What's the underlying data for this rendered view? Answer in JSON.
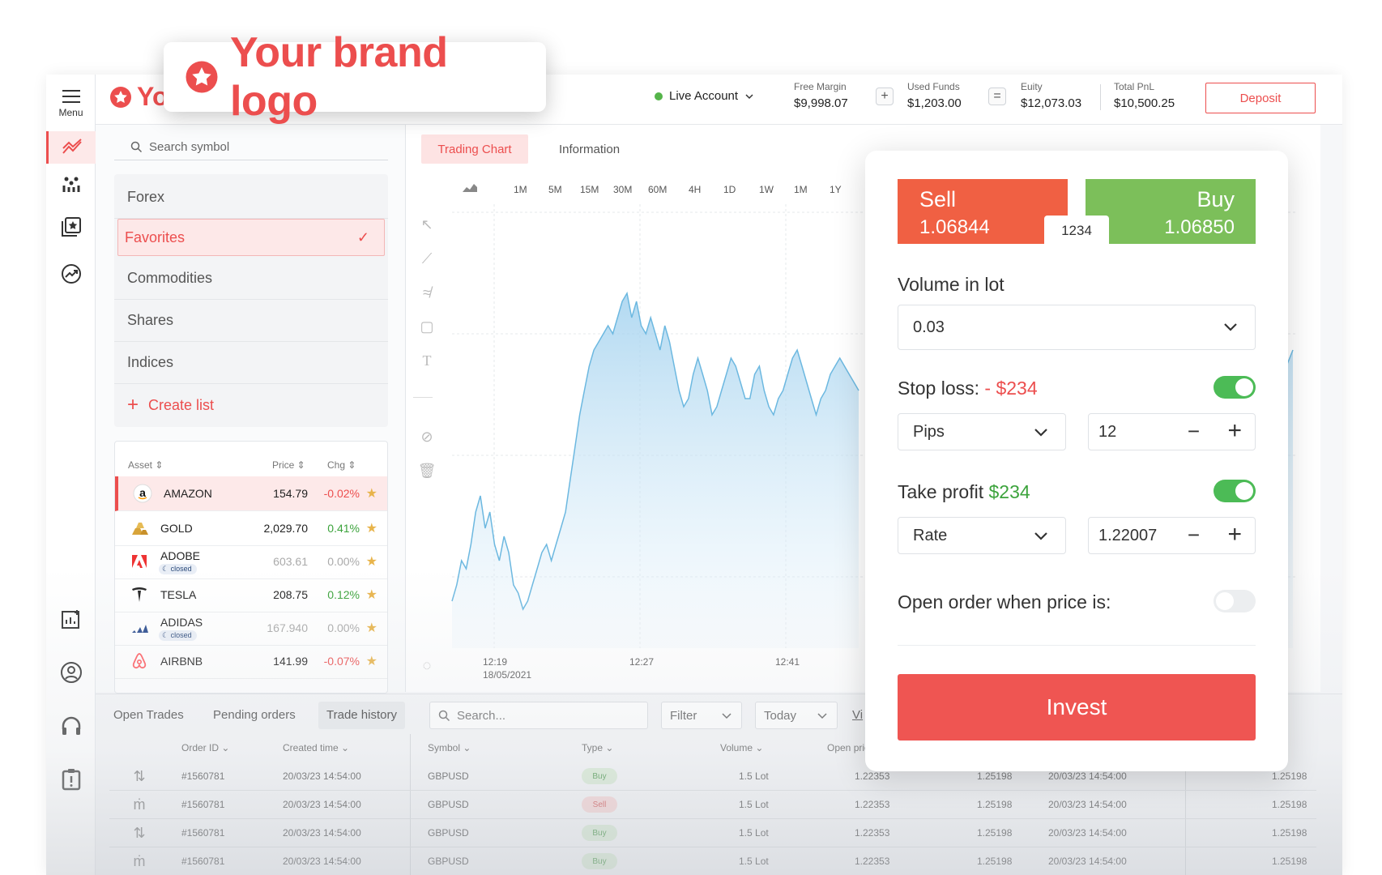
{
  "brand": {
    "logo_small": "Yo",
    "logo_popup": "Your brand logo",
    "accent": "#ec4e4e"
  },
  "rail": {
    "menu_label": "Menu"
  },
  "header": {
    "account": "Live Account",
    "stats": [
      {
        "label": "Free Margin",
        "value": "$9,998.07"
      },
      {
        "label": "Used Funds",
        "value": "$1,203.00"
      },
      {
        "label": "Euity",
        "value": "$12,073.03"
      },
      {
        "label": "Total PnL",
        "value": "$10,500.25"
      }
    ],
    "op_plus": "+",
    "op_equals": "=",
    "deposit": "Deposit"
  },
  "symbols": {
    "search_placeholder": "Search symbol",
    "categories": [
      "Forex",
      "Favorites",
      "Commodities",
      "Shares",
      "Indices"
    ],
    "create_list": "Create list",
    "columns": {
      "asset": "Asset",
      "price": "Price",
      "chg": "Chg"
    },
    "closed_label": "closed",
    "assets": [
      {
        "name": "AMAZON",
        "price": "154.79",
        "chg": "-0.02%",
        "trend": "neg",
        "closed": false,
        "icon": "a"
      },
      {
        "name": "GOLD",
        "price": "2,029.70",
        "chg": "0.41%",
        "trend": "pos",
        "closed": false,
        "icon": "gold"
      },
      {
        "name": "ADOBE",
        "price": "603.61",
        "chg": "0.00%",
        "trend": "zero",
        "closed": true,
        "icon": "adobe"
      },
      {
        "name": "TESLA",
        "price": "208.75",
        "chg": "0.12%",
        "trend": "pos",
        "closed": false,
        "icon": "T"
      },
      {
        "name": "ADIDAS",
        "price": "167.940",
        "chg": "0.00%",
        "trend": "zero",
        "closed": true,
        "icon": "adidas"
      },
      {
        "name": "AIRBNB",
        "price": "141.99",
        "chg": "-0.07%",
        "trend": "neg",
        "closed": false,
        "icon": "airbnb"
      }
    ]
  },
  "chart": {
    "tabs": [
      "Trading Chart",
      "Information"
    ],
    "timeframes": [
      "1M",
      "5M",
      "15M",
      "30M",
      "60M",
      "4H",
      "1D",
      "1W",
      "1M",
      "1Y"
    ],
    "x_labels": [
      "12:19",
      "18/05/2021",
      "12:27",
      "12:41"
    ],
    "line_color": "#6cb8e0"
  },
  "ticket": {
    "sell_label": "Sell",
    "sell_price": "1.06844",
    "buy_label": "Buy",
    "buy_price": "1.06850",
    "spread": "1234",
    "volume_label": "Volume in lot",
    "volume_value": "0.03",
    "stop_loss_label": "Stop loss:",
    "stop_loss_value": "- $234",
    "stop_loss_mode": "Pips",
    "stop_loss_amount": "12",
    "take_profit_label": "Take profit",
    "take_profit_value": "$234",
    "take_profit_mode": "Rate",
    "take_profit_amount": "1.22007",
    "open_order_label": "Open order when price is:",
    "invest": "Invest"
  },
  "trades": {
    "tabs": [
      "Open Trades",
      "Pending orders",
      "Trade history"
    ],
    "search_placeholder": "Search...",
    "filter": "Filter",
    "today": "Today",
    "view": "Vi",
    "columns": [
      "Order ID",
      "Created time",
      "Symbol",
      "Type",
      "Volume",
      "Open pric"
    ],
    "rows": [
      {
        "id": "#1560781",
        "time": "20/03/23 14:54:00",
        "symbol": "GBPUSD",
        "type": "Buy",
        "volume": "1.5 Lot",
        "open": "1.22353",
        "close": "1.25198",
        "closed_time": "20/03/23 14:54:00",
        "last": "1.25198"
      },
      {
        "id": "#1560781",
        "time": "20/03/23 14:54:00",
        "symbol": "GBPUSD",
        "type": "Sell",
        "volume": "1.5 Lot",
        "open": "1.22353",
        "close": "1.25198",
        "closed_time": "20/03/23 14:54:00",
        "last": "1.25198"
      },
      {
        "id": "#1560781",
        "time": "20/03/23 14:54:00",
        "symbol": "GBPUSD",
        "type": "Buy",
        "volume": "1.5 Lot",
        "open": "1.22353",
        "close": "1.25198",
        "closed_time": "20/03/23 14:54:00",
        "last": "1.25198"
      },
      {
        "id": "#1560781",
        "time": "20/03/23 14:54:00",
        "symbol": "GBPUSD",
        "type": "Buy",
        "volume": "1.5 Lot",
        "open": "1.22353",
        "close": "1.25198",
        "closed_time": "20/03/23 14:54:00",
        "last": "1.25198"
      }
    ]
  }
}
